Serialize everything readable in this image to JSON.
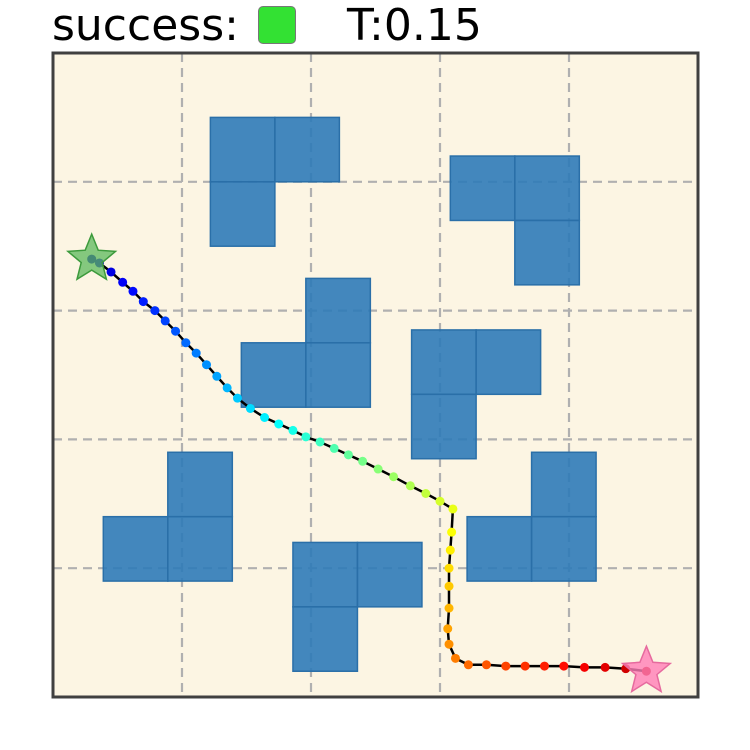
{
  "header": {
    "success_label": "success:",
    "success_color": "#33e133",
    "time_label": "T:0.15"
  },
  "chart_data": {
    "type": "scatter",
    "xlim": [
      0,
      5
    ],
    "ylim": [
      0,
      5
    ],
    "grid": true,
    "background": "#fcf5e3",
    "obstacle_color": "#2f7bb8",
    "obstacles": [
      [
        1.22,
        4.0,
        0.5,
        0.5
      ],
      [
        1.72,
        4.0,
        0.5,
        0.5
      ],
      [
        1.22,
        3.5,
        0.5,
        0.5
      ],
      [
        3.08,
        3.7,
        0.5,
        0.5
      ],
      [
        3.58,
        3.7,
        0.5,
        0.5
      ],
      [
        3.58,
        3.2,
        0.5,
        0.5
      ],
      [
        1.96,
        2.75,
        0.5,
        0.5
      ],
      [
        1.46,
        2.25,
        0.5,
        0.5
      ],
      [
        1.96,
        2.25,
        0.5,
        0.5
      ],
      [
        2.78,
        2.35,
        0.5,
        0.5
      ],
      [
        3.28,
        2.35,
        0.5,
        0.5
      ],
      [
        2.78,
        1.85,
        0.5,
        0.5
      ],
      [
        0.89,
        1.4,
        0.5,
        0.5
      ],
      [
        0.39,
        0.9,
        0.5,
        0.5
      ],
      [
        0.89,
        0.9,
        0.5,
        0.5
      ],
      [
        1.86,
        0.7,
        0.5,
        0.5
      ],
      [
        2.36,
        0.7,
        0.5,
        0.5
      ],
      [
        1.86,
        0.2,
        0.5,
        0.5
      ],
      [
        3.71,
        1.4,
        0.5,
        0.5
      ],
      [
        3.21,
        0.9,
        0.5,
        0.5
      ],
      [
        3.71,
        0.9,
        0.5,
        0.5
      ]
    ],
    "start": {
      "x": 0.3,
      "y": 3.4,
      "color": "#5cb85c"
    },
    "goal": {
      "x": 4.6,
      "y": 0.2,
      "color": "#ff7eb6"
    },
    "path": [
      [
        0.3,
        3.4
      ],
      [
        0.36,
        3.37
      ],
      [
        0.45,
        3.3
      ],
      [
        0.54,
        3.22
      ],
      [
        0.62,
        3.15
      ],
      [
        0.7,
        3.07
      ],
      [
        0.79,
        3.0
      ],
      [
        0.87,
        2.92
      ],
      [
        0.95,
        2.84
      ],
      [
        1.03,
        2.75
      ],
      [
        1.11,
        2.67
      ],
      [
        1.19,
        2.58
      ],
      [
        1.27,
        2.49
      ],
      [
        1.35,
        2.4
      ],
      [
        1.43,
        2.32
      ],
      [
        1.53,
        2.24
      ],
      [
        1.64,
        2.17
      ],
      [
        1.75,
        2.12
      ],
      [
        1.86,
        2.07
      ],
      [
        1.96,
        2.02
      ],
      [
        2.07,
        1.98
      ],
      [
        2.18,
        1.93
      ],
      [
        2.29,
        1.88
      ],
      [
        2.4,
        1.83
      ],
      [
        2.52,
        1.77
      ],
      [
        2.64,
        1.71
      ],
      [
        2.77,
        1.64
      ],
      [
        2.89,
        1.58
      ],
      [
        3.0,
        1.52
      ],
      [
        3.1,
        1.46
      ],
      [
        3.09,
        1.28
      ],
      [
        3.08,
        1.14
      ],
      [
        3.07,
        1.0
      ],
      [
        3.07,
        0.86
      ],
      [
        3.07,
        0.69
      ],
      [
        3.06,
        0.53
      ],
      [
        3.07,
        0.41
      ],
      [
        3.12,
        0.3
      ],
      [
        3.22,
        0.25
      ],
      [
        3.36,
        0.25
      ],
      [
        3.51,
        0.24
      ],
      [
        3.66,
        0.24
      ],
      [
        3.81,
        0.24
      ],
      [
        3.96,
        0.24
      ],
      [
        4.12,
        0.23
      ],
      [
        4.28,
        0.23
      ],
      [
        4.44,
        0.22
      ],
      [
        4.6,
        0.2
      ]
    ]
  }
}
